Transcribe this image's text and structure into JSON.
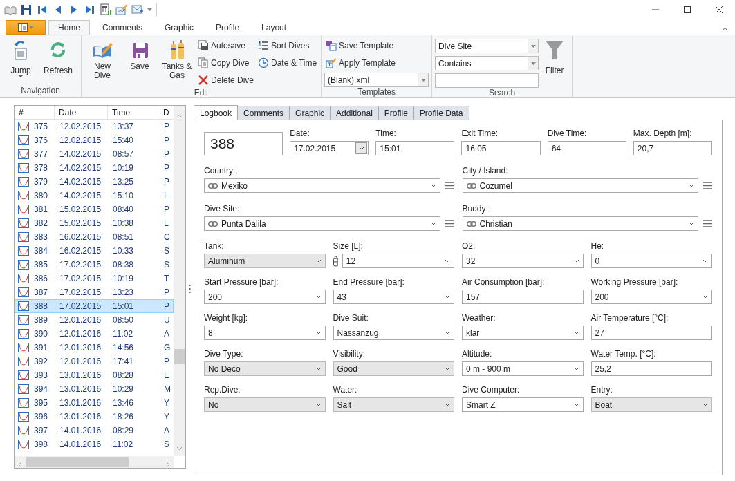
{
  "ribbon": {
    "tabs": [
      {
        "label": "Home",
        "selected": true
      },
      {
        "label": "Comments",
        "selected": false
      },
      {
        "label": "Graphic",
        "selected": false
      },
      {
        "label": "Profile",
        "selected": false
      },
      {
        "label": "Layout",
        "selected": false
      }
    ],
    "navigation": {
      "title": "Navigation",
      "buttons": [
        "Jump",
        "Refresh"
      ]
    },
    "edit": {
      "title": "Edit",
      "large_buttons": [
        "New Dive",
        "Save",
        "Tanks & Gas"
      ],
      "small_buttons": [
        "Autosave",
        "Copy Dive",
        "Delete Dive",
        "Sort Dives",
        "Date & Time"
      ]
    },
    "templates": {
      "title": "Templates",
      "buttons": [
        "Save Template",
        "Apply Template"
      ],
      "template_combo": "(Blank).xml"
    },
    "search": {
      "title": "Search",
      "field_combo": "Dive Site",
      "match_combo": "Contains",
      "filter_button": "Filter"
    }
  },
  "dive_list": {
    "columns": [
      "#",
      "Date",
      "Time",
      "D"
    ],
    "rows": [
      {
        "cells": [
          "375",
          "12.02.2015",
          "13:37",
          "P"
        ],
        "selected": false
      },
      {
        "cells": [
          "376",
          "12.02.2015",
          "15:40",
          "P"
        ],
        "selected": false
      },
      {
        "cells": [
          "377",
          "14.02.2015",
          "08:57",
          "P"
        ],
        "selected": false
      },
      {
        "cells": [
          "378",
          "14.02.2015",
          "10:19",
          "P"
        ],
        "selected": false
      },
      {
        "cells": [
          "379",
          "14.02.2015",
          "13:25",
          "P"
        ],
        "selected": false
      },
      {
        "cells": [
          "380",
          "14.02.2015",
          "15:10",
          "L"
        ],
        "selected": false
      },
      {
        "cells": [
          "381",
          "15.02.2015",
          "08:40",
          "P"
        ],
        "selected": false
      },
      {
        "cells": [
          "382",
          "15.02.2015",
          "10:38",
          "L"
        ],
        "selected": false
      },
      {
        "cells": [
          "383",
          "16.02.2015",
          "08:51",
          "C"
        ],
        "selected": false
      },
      {
        "cells": [
          "384",
          "16.02.2015",
          "10:33",
          "S"
        ],
        "selected": false
      },
      {
        "cells": [
          "385",
          "17.02.2015",
          "08:38",
          "S"
        ],
        "selected": false
      },
      {
        "cells": [
          "386",
          "17.02.2015",
          "10:19",
          "T"
        ],
        "selected": false
      },
      {
        "cells": [
          "387",
          "17.02.2015",
          "13:23",
          "P"
        ],
        "selected": false
      },
      {
        "cells": [
          "388",
          "17.02.2015",
          "15:01",
          "P"
        ],
        "selected": true
      },
      {
        "cells": [
          "389",
          "12.01.2016",
          "08:50",
          "U"
        ],
        "selected": false
      },
      {
        "cells": [
          "390",
          "12.01.2016",
          "11:02",
          "A"
        ],
        "selected": false
      },
      {
        "cells": [
          "391",
          "12.01.2016",
          "14:56",
          "G"
        ],
        "selected": false
      },
      {
        "cells": [
          "392",
          "12.01.2016",
          "17:41",
          "P"
        ],
        "selected": false
      },
      {
        "cells": [
          "393",
          "13.01.2016",
          "08:28",
          "E"
        ],
        "selected": false
      },
      {
        "cells": [
          "394",
          "13.01.2016",
          "10:29",
          "M"
        ],
        "selected": false
      },
      {
        "cells": [
          "395",
          "13.01.2016",
          "13:46",
          "Y"
        ],
        "selected": false
      },
      {
        "cells": [
          "396",
          "13.01.2016",
          "18:26",
          "Y"
        ],
        "selected": false
      },
      {
        "cells": [
          "397",
          "14.01.2016",
          "08:29",
          "A"
        ],
        "selected": false
      },
      {
        "cells": [
          "398",
          "14.01.2016",
          "11:02",
          "S"
        ],
        "selected": false
      }
    ]
  },
  "detail_tabs": [
    {
      "label": "Logbook",
      "selected": true
    },
    {
      "label": "Comments",
      "selected": false
    },
    {
      "label": "Graphic",
      "selected": false
    },
    {
      "label": "Additional",
      "selected": false
    },
    {
      "label": "Profile",
      "selected": false
    },
    {
      "label": "Profile Data",
      "selected": false
    }
  ],
  "logbook": {
    "dive_number": "388",
    "top_fields": [
      {
        "label": "Date:",
        "value": "17.02.2015",
        "kind": "date"
      },
      {
        "label": "Time:",
        "value": "15:01",
        "kind": "text"
      },
      {
        "label": "Exit Time:",
        "value": "16:05",
        "kind": "text"
      },
      {
        "label": "Dive Time:",
        "value": "64",
        "kind": "text"
      },
      {
        "label": "Max. Depth [m]:",
        "value": "20,7",
        "kind": "text"
      }
    ],
    "linked_fields": [
      {
        "label": "Country:",
        "value": "Mexiko"
      },
      {
        "label": "City / Island:",
        "value": "Cozumel"
      },
      {
        "label": "Dive Site:",
        "value": "Punta Dalila"
      },
      {
        "label": "Buddy:",
        "value": "Christian"
      }
    ],
    "fields": [
      {
        "label": "Tank:",
        "value": "Aluminum",
        "kind": "select"
      },
      {
        "label": "Size [L]:",
        "value": "12",
        "kind": "tank-dropdown"
      },
      {
        "label": "O2:",
        "value": "32",
        "kind": "dropdown"
      },
      {
        "label": "He:",
        "value": "0",
        "kind": "dropdown"
      },
      {
        "label": "Start Pressure [bar]:",
        "value": "200",
        "kind": "dropdown"
      },
      {
        "label": "End Pressure [bar]:",
        "value": "43",
        "kind": "dropdown"
      },
      {
        "label": "Air Consumption [bar]:",
        "value": "157",
        "kind": "text"
      },
      {
        "label": "Working Pressure [bar]:",
        "value": "200",
        "kind": "dropdown"
      },
      {
        "label": "Weight [kg]:",
        "value": "8",
        "kind": "dropdown"
      },
      {
        "label": "Dive Suit:",
        "value": "Nassanzug",
        "kind": "dropdown"
      },
      {
        "label": "Weather:",
        "value": "klar",
        "kind": "dropdown"
      },
      {
        "label": "Air Temperature [°C]:",
        "value": "27",
        "kind": "text"
      },
      {
        "label": "Dive Type:",
        "value": "No Deco",
        "kind": "select"
      },
      {
        "label": "Visibility:",
        "value": "Good",
        "kind": "select"
      },
      {
        "label": "Altitude:",
        "value": "0 m - 900 m",
        "kind": "dropdown"
      },
      {
        "label": "Water Temp. [°C]:",
        "value": "25,2",
        "kind": "text"
      },
      {
        "label": "Rep.Dive:",
        "value": "No",
        "kind": "select"
      },
      {
        "label": "Water:",
        "value": "Salt",
        "kind": "select"
      },
      {
        "label": "Dive Computer:",
        "value": "Smart Z",
        "kind": "dropdown"
      },
      {
        "label": "Entry:",
        "value": "Boat",
        "kind": "select"
      }
    ]
  }
}
